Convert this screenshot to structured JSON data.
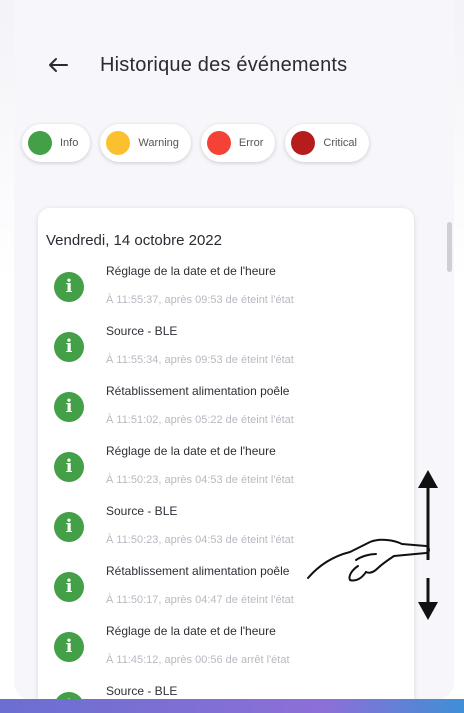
{
  "header": {
    "back_icon": "arrow-left-icon",
    "title": "Historique des événements"
  },
  "filters": [
    {
      "label": "Info",
      "color": "#43a047"
    },
    {
      "label": "Warning",
      "color": "#fbc02d"
    },
    {
      "label": "Error",
      "color": "#f44336"
    },
    {
      "label": "Critical",
      "color": "#b71c1c"
    }
  ],
  "events_card": {
    "date": "Vendredi, 14 octobre 2022",
    "events": [
      {
        "title": "Réglage de la date et de l'heure",
        "detail": "À 11:55:37, après 09:53 de éteint l'état",
        "icon": "info-icon"
      },
      {
        "title": "Source - BLE",
        "detail": "À 11:55:34, après 09:53 de éteint l'état",
        "icon": "info-icon"
      },
      {
        "title": "Rétablissement alimentation poêle",
        "detail": "À 11:51:02, après 05:22 de éteint l'état",
        "icon": "info-icon"
      },
      {
        "title": "Réglage de la date et de l'heure",
        "detail": "À 11:50:23, après 04:53 de éteint l'état",
        "icon": "info-icon"
      },
      {
        "title": "Source - BLE",
        "detail": "À 11:50:23, après 04:53 de éteint l'état",
        "icon": "info-icon"
      },
      {
        "title": "Rétablissement alimentation poêle",
        "detail": "À 11:50:17, après 04:47 de éteint l'état",
        "icon": "info-icon"
      },
      {
        "title": "Réglage de la date et de l'heure",
        "detail": "À 11:45:12, après 00:56 de arrêt l'état",
        "icon": "info-icon"
      },
      {
        "title": "Source - BLE",
        "detail": "",
        "icon": "info-icon"
      }
    ]
  },
  "gesture_hint": {
    "icon": "swipe-up-down-hand-icon"
  }
}
